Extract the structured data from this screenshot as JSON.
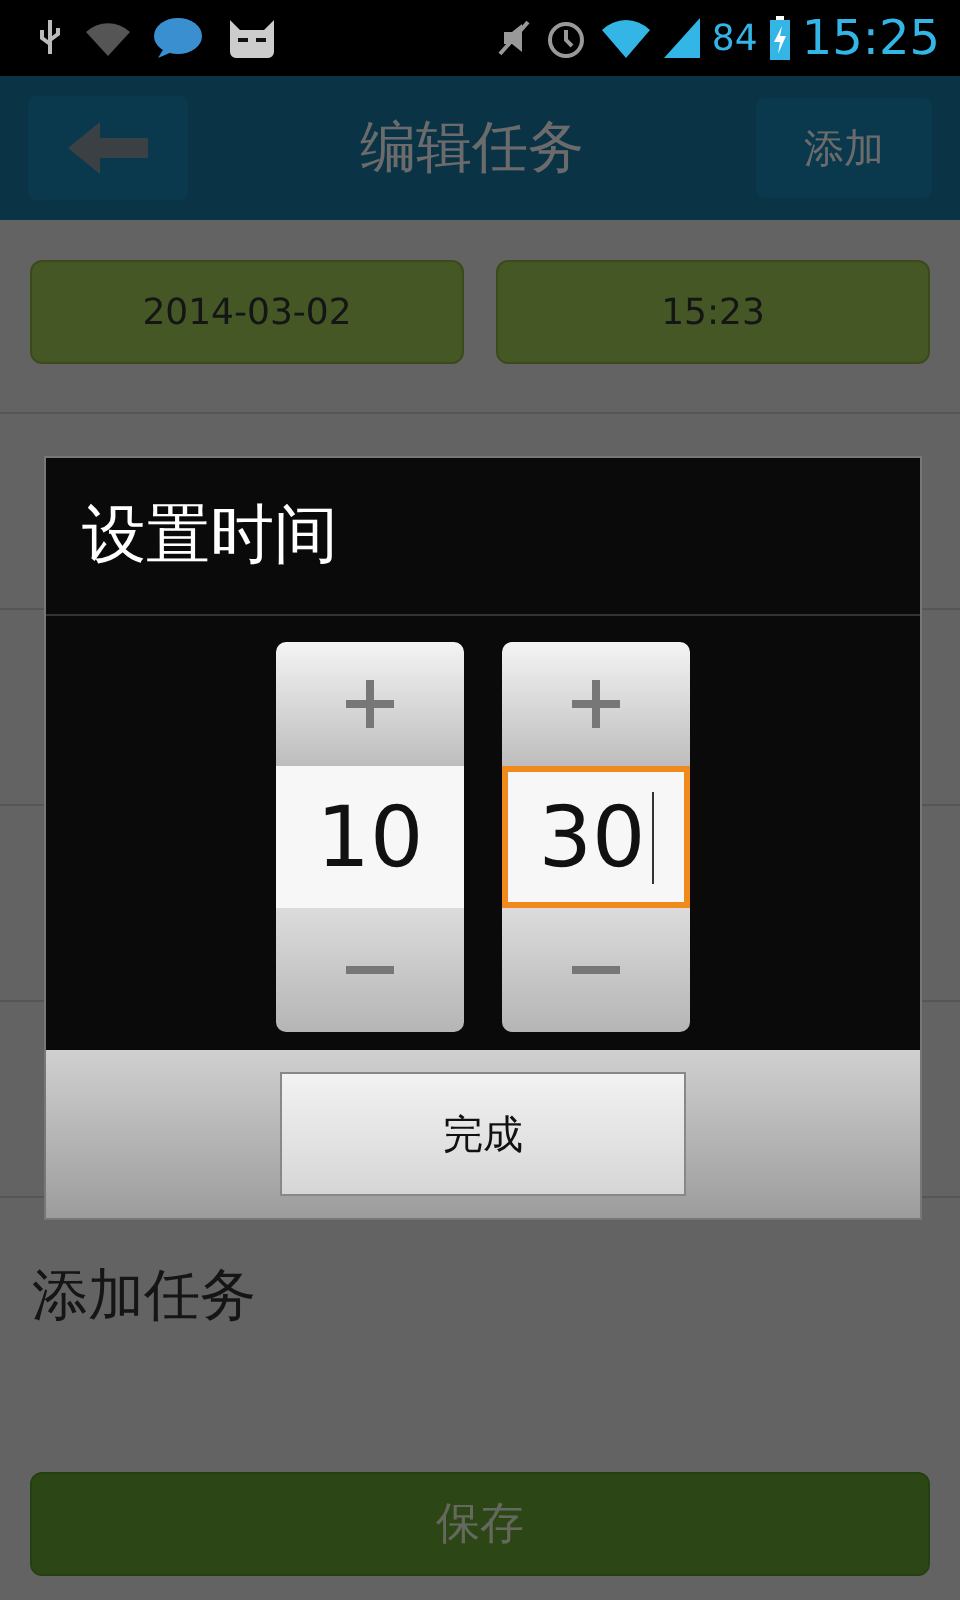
{
  "status_bar": {
    "battery": "84",
    "time": "15:25"
  },
  "header": {
    "title": "编辑任务",
    "action": "添加"
  },
  "date_time": [
    "2014-03-02",
    "15:23"
  ],
  "rows": [
    {
      "label": "添加任务"
    }
  ],
  "save_button": "保存",
  "dialog": {
    "title": "设置时间",
    "pickers": [
      {
        "value": "10",
        "focused": false
      },
      {
        "value": "30",
        "focused": true
      }
    ],
    "done": "完成"
  }
}
